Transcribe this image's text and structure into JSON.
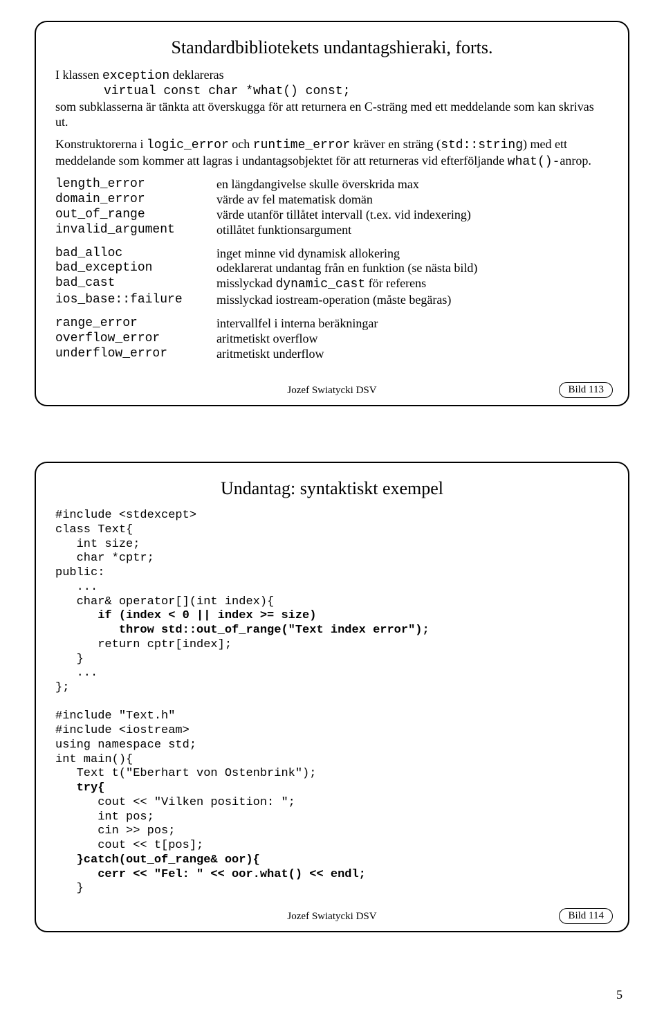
{
  "slide1": {
    "title": "Standardbibliotekets undantagshieraki, forts.",
    "intro1_pre": "I klassen ",
    "intro1_code": "exception",
    "intro1_post": " deklareras",
    "intro2": "virtual const char *what() const;",
    "intro3": "som subklasserna är tänkta att överskugga för att returnera en C-sträng med ett meddelande som kan skrivas ut.",
    "para2_a": "Konstruktorerna i ",
    "para2_b": "logic_error",
    "para2_c": " och ",
    "para2_d": "runtime_error",
    "para2_e": " kräver en sträng (",
    "para2_f": "std::string",
    "para2_g": ") med ett meddelande som kommer att lagras i undantagsobjektet för att returneras vid efterföljande ",
    "para2_h": "what()-",
    "para2_i": "anrop.",
    "g1": {
      "t1": "length_error",
      "d1": "en längdangivelse skulle överskrida max",
      "t2": "domain_error",
      "d2": "värde av fel matematisk domän",
      "t3": "out_of_range",
      "d3": "värde utanför tillåtet intervall (t.ex. vid indexering)",
      "t4": "invalid_argument",
      "d4": "otillåtet funktionsargument"
    },
    "g2": {
      "t1": "bad_alloc",
      "d1": "inget minne vid dynamisk allokering",
      "t2": "bad_exception",
      "d2": "odeklarerat undantag från en funktion (se nästa bild)",
      "t3": "bad_cast",
      "d3a": "misslyckad ",
      "d3b": "dynamic_cast",
      "d3c": " för referens",
      "t4": "ios_base::failure",
      "d4": "misslyckad iostream-operation (måste begäras)"
    },
    "g3": {
      "t1": "range_error",
      "d1": "intervallfel i interna beräkningar",
      "t2": "overflow_error",
      "d2": "aritmetiskt overflow",
      "t3": "underflow_error",
      "d3": "aritmetiskt underflow"
    },
    "author": "Jozef Swiatycki DSV",
    "num": "Bild 113"
  },
  "slide2": {
    "title": "Undantag: syntaktiskt exempel",
    "lines": {
      "l01": "#include <stdexcept>",
      "l02": "class Text{",
      "l03": "   int size;",
      "l04": "   char *cptr;",
      "l05": "public:",
      "l06": "   ...",
      "l07": "   char& operator[](int index){",
      "l08": "      if (index < 0 || index >= size)",
      "l09": "         throw std::out_of_range(\"Text index error\");",
      "l10": "      return cptr[index];",
      "l11": "   }",
      "l12": "   ...",
      "l13": "};",
      "l14": "",
      "l15": "#include \"Text.h\"",
      "l16": "#include <iostream>",
      "l17": "using namespace std;",
      "l18": "int main(){",
      "l19": "   Text t(\"Eberhart von Ostenbrink\");",
      "l20": "   try{",
      "l21": "      cout << \"Vilken position: \";",
      "l22": "      int pos;",
      "l23": "      cin >> pos;",
      "l24": "      cout << t[pos];",
      "l25": "   }catch(out_of_range& oor){",
      "l26": "      cerr << \"Fel: \" << oor.what() << endl;",
      "l27": "   }"
    },
    "author": "Jozef Swiatycki DSV",
    "num": "Bild 114"
  },
  "pageNum": "5"
}
